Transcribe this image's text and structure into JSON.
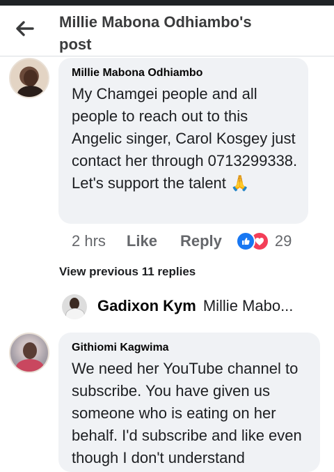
{
  "header": {
    "title": "Millie Mabona Odhiambo's post",
    "back_icon": "arrow-left-icon"
  },
  "comments": [
    {
      "author": "Millie Mabona Odhiambo",
      "text": "My Chamgei people and all people to reach out to this Angelic singer, Carol Kosgey just contact her through 0713299338. Let's support the talent 🙏",
      "time": "2 hrs",
      "like_label": "Like",
      "reply_label": "Reply",
      "reactions": {
        "types": [
          "like",
          "love"
        ],
        "count": "29"
      }
    },
    {
      "author": "Githiomi Kagwima",
      "text": "We need her YouTube channel to subscribe. You have given us someone who is eating on her behalf. I'd subscribe and like even though I don't understand"
    }
  ],
  "view_previous_replies": "View previous 11 replies",
  "reply_preview": {
    "author": "Gadixon Kym",
    "snippet": "Millie Mabo..."
  },
  "colors": {
    "bubble": "#f0f2f5",
    "like_blue": "#1877f2",
    "love_red": "#f33e58",
    "meta_gray": "#65676b"
  }
}
